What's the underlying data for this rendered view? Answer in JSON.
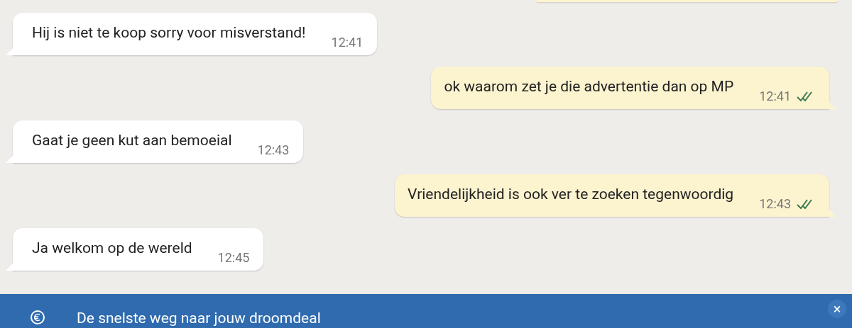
{
  "messages": [
    {
      "kind": "incoming",
      "text": "Hij is niet te koop sorry voor misverstand!",
      "time": "12:41"
    },
    {
      "kind": "outgoing",
      "text": "ok waarom zet je die advertentie dan op MP",
      "time": "12:41",
      "read": true
    },
    {
      "kind": "incoming",
      "text": "Gaat je geen kut aan bemoeial",
      "time": "12:43"
    },
    {
      "kind": "outgoing",
      "text": "Vriendelijkheid is ook ver te zoeken tegenwoordig",
      "time": "12:43",
      "read": true
    },
    {
      "kind": "incoming",
      "text": "Ja welkom op de wereld",
      "time": "12:45"
    }
  ],
  "banner": {
    "text": "De snelste weg naar jouw droomdeal",
    "close": "×"
  }
}
